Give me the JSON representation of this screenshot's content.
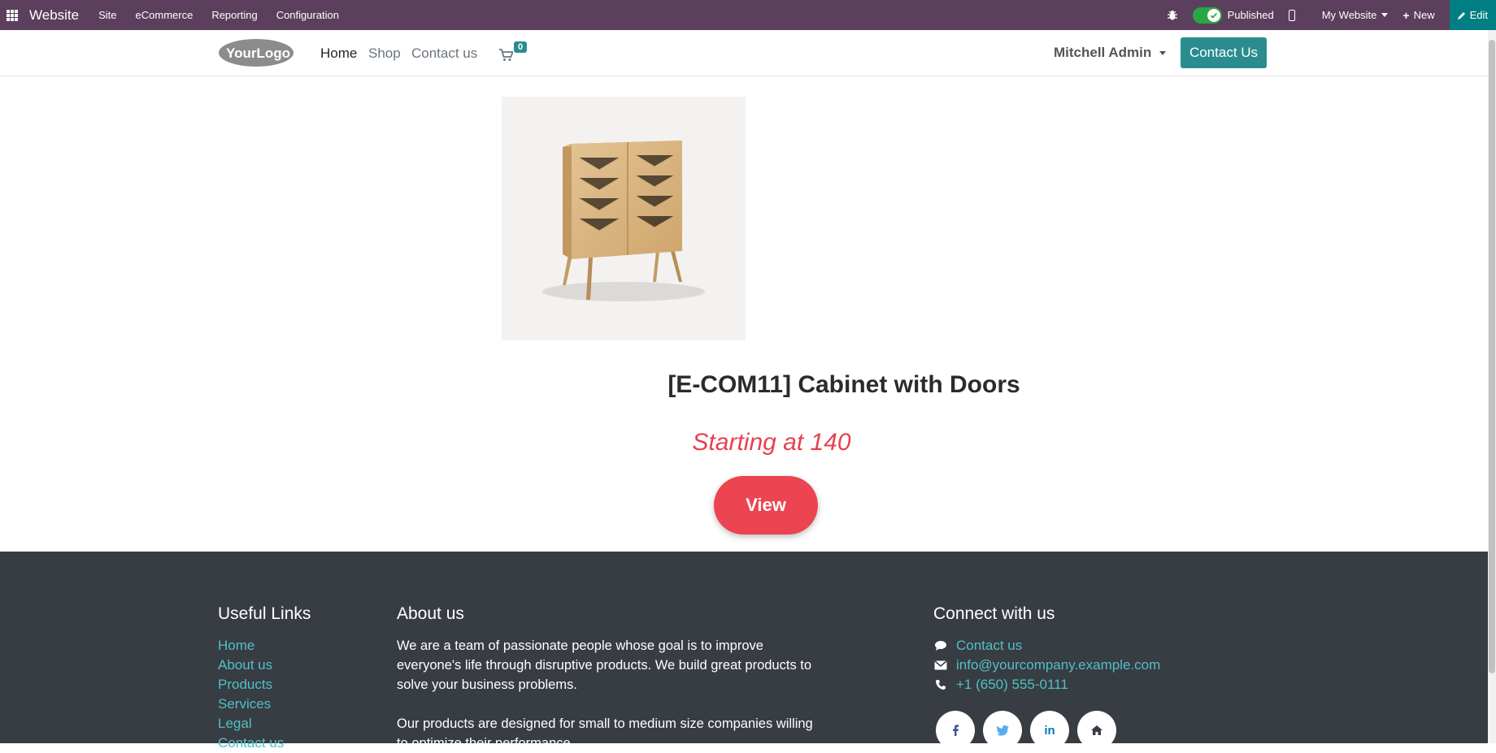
{
  "admin_bar": {
    "brand": "Website",
    "menu": [
      "Site",
      "eCommerce",
      "Reporting",
      "Configuration"
    ],
    "published_label": "Published",
    "website_selector": "My Website",
    "new_label": "New",
    "edit_label": "Edit",
    "color": "#5b3f5d"
  },
  "header": {
    "logo_text": "YourLogo",
    "nav": [
      "Home",
      "Shop",
      "Contact us"
    ],
    "cart_count": "0",
    "user": "Mitchell Admin",
    "cta": "Contact Us",
    "accent": "#2b8c8f"
  },
  "product": {
    "image_name": "cabinet-with-doors",
    "title": "[E-COM11] Cabinet with Doors",
    "price": "Starting at 140",
    "view_label": "View",
    "price_color": "#e8414e"
  },
  "footer": {
    "useful_links_title": "Useful Links",
    "useful_links": [
      "Home",
      "About us",
      "Products",
      "Services",
      "Legal",
      "Contact us"
    ],
    "about_title": "About us",
    "about_p1": "We are a team of passionate people whose goal is to improve everyone's life through disruptive products. We build great products to solve your business problems.",
    "about_p2": "Our products are designed for small to medium size companies willing to optimize their performance.",
    "connect_title": "Connect with us",
    "contact_link": "Contact us",
    "email": "info@yourcompany.example.com",
    "phone": "+1 (650) 555-0111",
    "social": [
      "facebook-icon",
      "twitter-icon",
      "linkedin-icon",
      "home-icon"
    ],
    "bg": "#383c43",
    "link_color": "#4fc1c4"
  }
}
